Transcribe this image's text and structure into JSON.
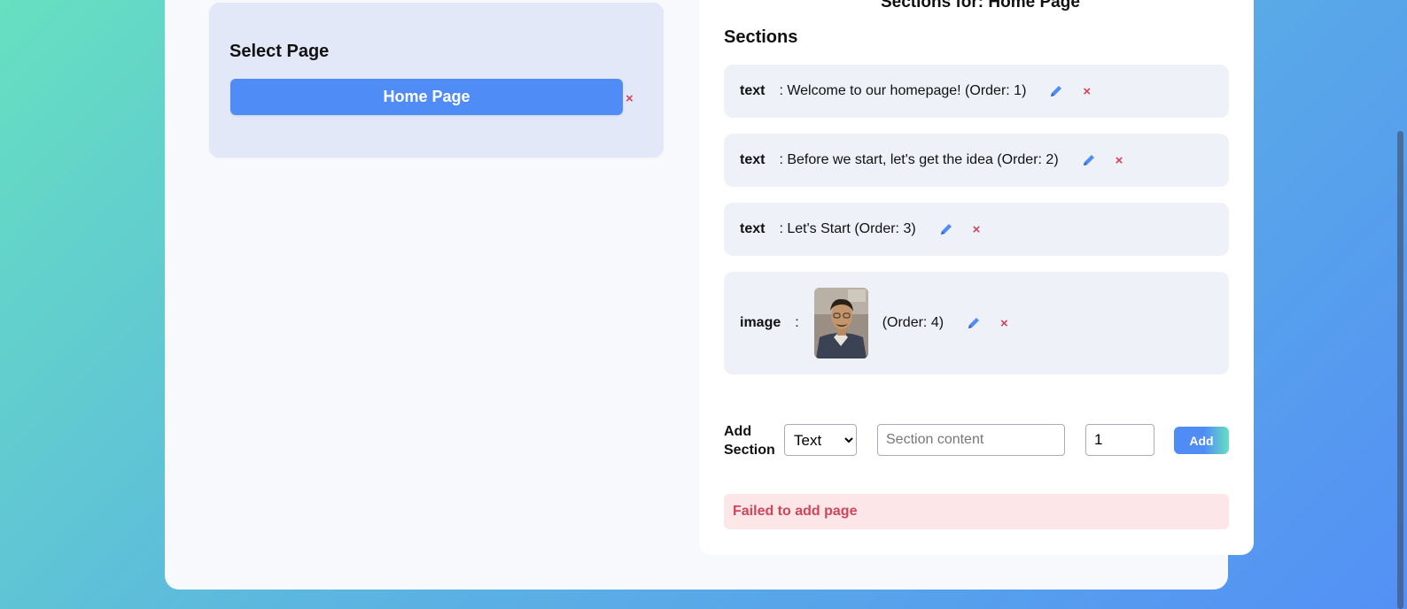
{
  "left_panel": {
    "title": "Select Page",
    "page_button_label": "Home Page",
    "delete_symbol": "×"
  },
  "right_panel": {
    "title": "Sections for: Home Page",
    "sections_heading": "Sections",
    "sections": [
      {
        "type": "text",
        "content": ": Welcome to our homepage! (Order: 1)",
        "edit_icon": "pencil-icon",
        "delete_symbol": "×"
      },
      {
        "type": "text",
        "content": ": Before we start, let's get the idea (Order: 2)",
        "edit_icon": "pencil-icon",
        "delete_symbol": "×"
      },
      {
        "type": "text",
        "content": ": Let's Start (Order: 3)",
        "edit_icon": "pencil-icon",
        "delete_symbol": "×"
      },
      {
        "type": "image",
        "colon": ":",
        "content": "(Order: 4)",
        "edit_icon": "pencil-icon",
        "delete_symbol": "×"
      }
    ]
  },
  "add_section": {
    "label_line1": "Add",
    "label_line2": "Section",
    "type_options": [
      "Text"
    ],
    "type_selected": "Text",
    "content_placeholder": "Section content",
    "content_value": "",
    "order_value": "1",
    "add_button_label": "Add"
  },
  "error_message": "Failed to add page",
  "colors": {
    "accent": "#4f8cf5",
    "danger": "#d0455a",
    "error_bg": "#fde6e8"
  }
}
